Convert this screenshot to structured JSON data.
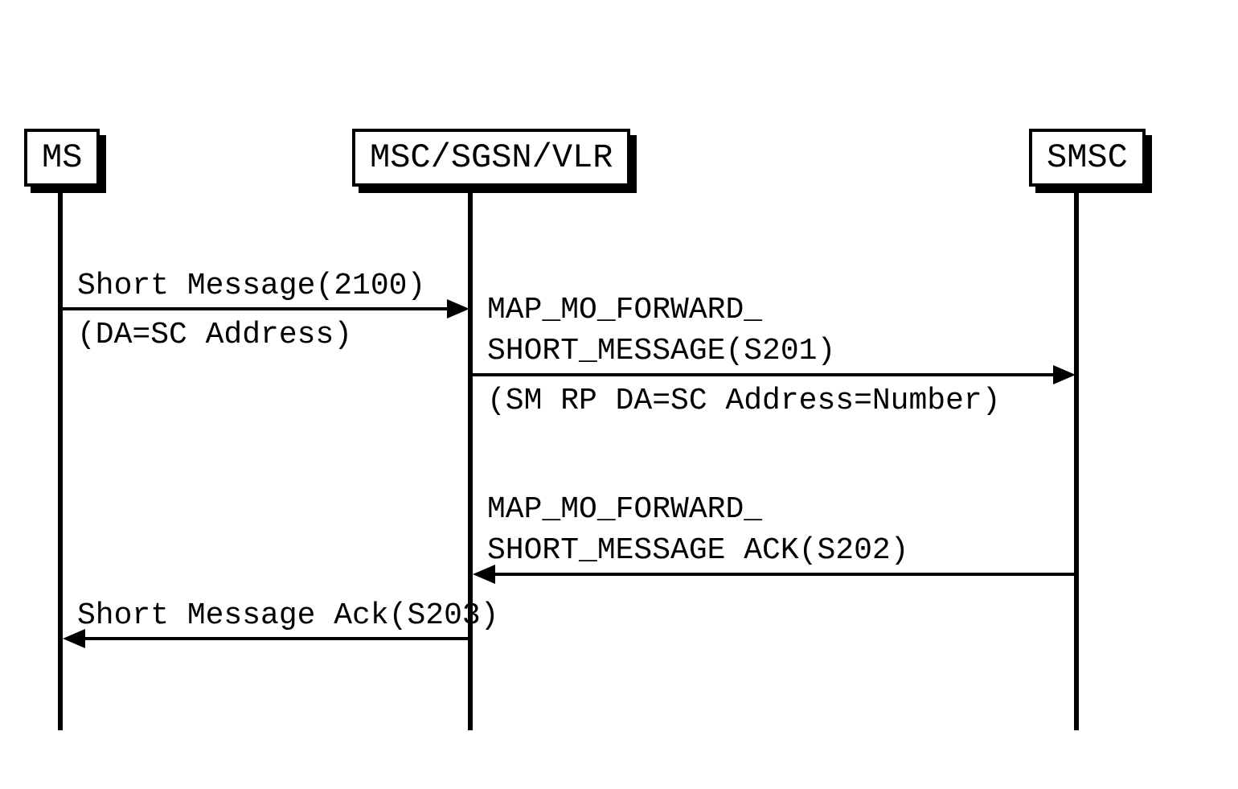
{
  "participants": {
    "ms": {
      "label": "MS"
    },
    "mscsgsn": {
      "label": "MSC/SGSN/VLR"
    },
    "smsc": {
      "label": "SMSC"
    }
  },
  "messages": {
    "msg1": {
      "line1": "Short Message(2100)",
      "line2": "(DA=SC Address)"
    },
    "msg2": {
      "line1": "MAP_MO_FORWARD_",
      "line2": "SHORT_MESSAGE(S201)",
      "line3": "(SM RP DA=SC Address=Number)"
    },
    "msg3": {
      "line1": "MAP_MO_FORWARD_",
      "line2": "SHORT_MESSAGE ACK(S202)"
    },
    "msg4": {
      "line1": "Short Message Ack(S203)"
    }
  }
}
